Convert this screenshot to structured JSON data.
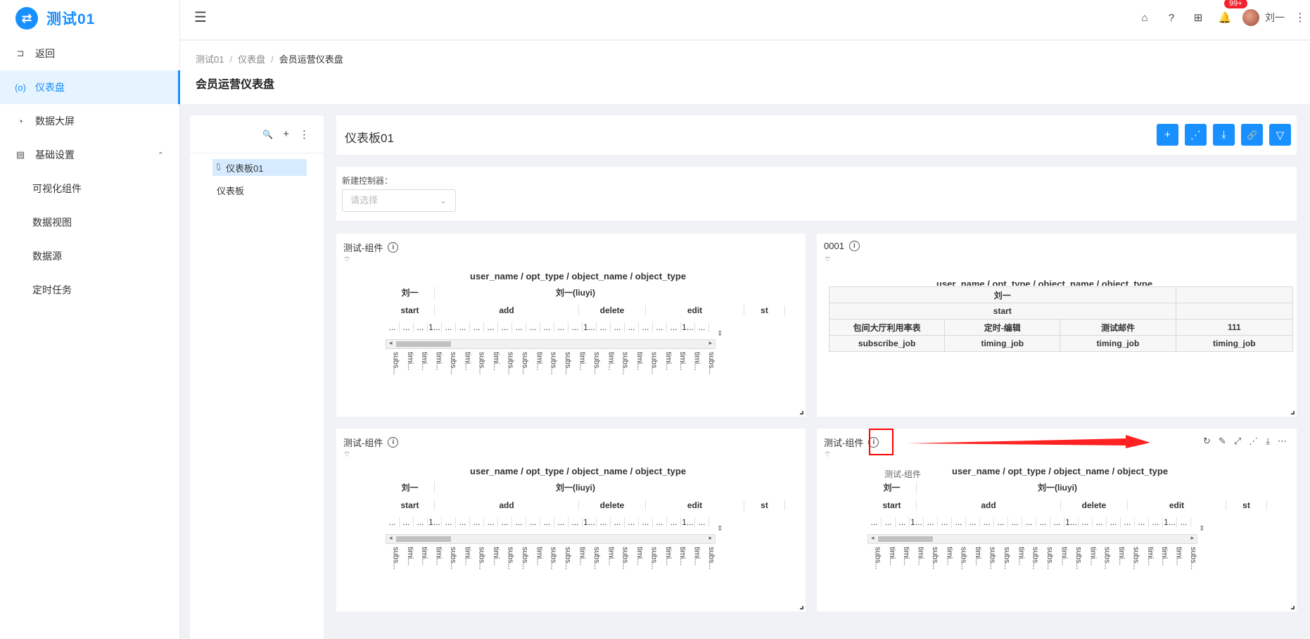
{
  "app": {
    "logo_glyph": "⇄",
    "title": "测试01"
  },
  "sidebar": {
    "items": [
      {
        "label": "返回",
        "icon": "return-icon",
        "glyph": "⊐"
      },
      {
        "label": "仪表盘",
        "icon": "dashboard-icon",
        "glyph": "(o)",
        "active": true
      },
      {
        "label": "数据大屏",
        "icon": "pie-chart-icon",
        "glyph": "◔"
      },
      {
        "label": "基础设置",
        "icon": "settings-book-icon",
        "glyph": "▤",
        "chevron": "⌃"
      }
    ],
    "sub_items": [
      {
        "label": "可视化组件"
      },
      {
        "label": "数据视图"
      },
      {
        "label": "数据源"
      },
      {
        "label": "定时任务"
      }
    ]
  },
  "header": {
    "collapse_glyph": "☰",
    "home_glyph": "⌂",
    "help_glyph": "?",
    "apps_glyph": "⊞",
    "bell_glyph": "🔔",
    "badge": "99+",
    "user_name": "刘一",
    "more_glyph": "⋮"
  },
  "page": {
    "breadcrumb": [
      "测试01",
      "仪表盘",
      "会员运营仪表盘"
    ],
    "breadcrumb_sep": "/",
    "title": "会员运营仪表盘"
  },
  "tree": {
    "search_glyph": "🔍",
    "add_glyph": "+",
    "more_glyph": "⋮",
    "nodes": [
      {
        "label": "仪表板01",
        "glyph": "⩇",
        "selected": true
      },
      {
        "label": "仪表板"
      }
    ]
  },
  "dashboard": {
    "name": "仪表板01",
    "actions": [
      {
        "name": "add",
        "glyph": "+"
      },
      {
        "name": "share",
        "glyph": "⋰"
      },
      {
        "name": "download",
        "glyph": "⤓"
      },
      {
        "name": "link",
        "glyph": "🔗"
      },
      {
        "name": "filter",
        "glyph": "▽"
      }
    ]
  },
  "controller": {
    "label": "新建控制器：",
    "placeholder": "请选择",
    "arrow": "⌄"
  },
  "pivot": {
    "header_title": "user_name / opt_type / object_name / object_type",
    "row1": [
      "刘一",
      "刘一(liuyi)"
    ],
    "row2": [
      "start",
      "add",
      "delete",
      "edit",
      "st"
    ],
    "dots": [
      "...",
      "...",
      "...",
      "1...",
      "...",
      "...",
      "...",
      "...",
      "...",
      "...",
      "...",
      "...",
      "...",
      "...",
      "1...",
      "...",
      "...",
      "...",
      "...",
      "...",
      "...",
      "1...",
      "..."
    ],
    "vlabels": [
      "subs...",
      "timi...",
      "timi...",
      "timi...",
      "subs...",
      "timi...",
      "subs...",
      "timi...",
      "subs...",
      "subs...",
      "timi...",
      "subs...",
      "subs...",
      "timi...",
      "subs...",
      "timi...",
      "subs...",
      "timi...",
      "subs...",
      "timi...",
      "timi...",
      "timi...",
      "subs..."
    ],
    "scroll_left": "◂",
    "scroll_right": "▸",
    "scroll_updown": "⇕"
  },
  "cards": [
    {
      "title": "测试-组件",
      "info": "i",
      "sub_glyph": "⌔"
    },
    {
      "title": "0001",
      "info": "i",
      "sub_glyph": "⌔"
    },
    {
      "title": "测试-组件",
      "info": "i",
      "sub_glyph": "⌔"
    },
    {
      "title": "测试-组件",
      "info": "i",
      "sub_glyph": "⌔",
      "tooltip": "测试-组件"
    }
  ],
  "table2": {
    "header_title": "user_name / opt_type / object_name / object_type",
    "row1": "刘一",
    "row2": "start",
    "row3": [
      "包间大厅利用率表",
      "定时-编辑",
      "测试邮件",
      "111"
    ],
    "row4": [
      "subscribe_job",
      "timing_job",
      "timing_job",
      "timing_job"
    ]
  },
  "card_tools": [
    {
      "name": "refresh",
      "glyph": "↻"
    },
    {
      "name": "edit",
      "glyph": "✎"
    },
    {
      "name": "fullscreen",
      "glyph": "⤢"
    },
    {
      "name": "share",
      "glyph": "⋰"
    },
    {
      "name": "download",
      "glyph": "⤓"
    },
    {
      "name": "more",
      "glyph": "⋯"
    }
  ],
  "colors": {
    "accent": "#1890ff",
    "annotation": "#ff0000"
  }
}
